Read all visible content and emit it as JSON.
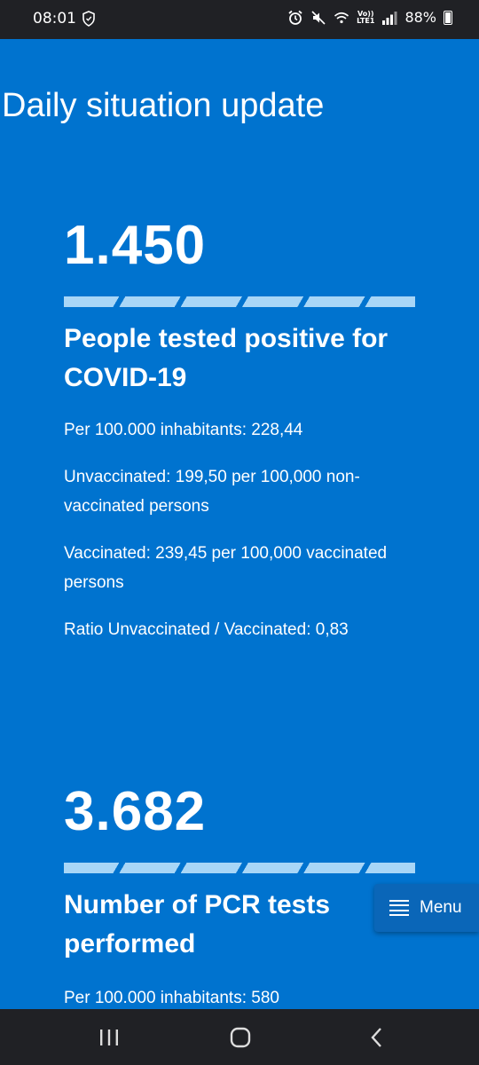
{
  "status_bar": {
    "time": "08:01",
    "battery_text": "88%",
    "network_label_top": "Vo))",
    "network_label_bottom": "LTE1"
  },
  "page_title": "Daily situation update",
  "stat_positive": {
    "value": "1.450",
    "heading": "People tested positive for COVID-19",
    "lines": [
      "Per 100.000 inhabitants: 228,44",
      "Unvaccinated: 199,50  per 100,000 non-vaccinated persons",
      "Vaccinated: 239,45  per 100,000 vaccinated persons",
      "Ratio Unvaccinated / Vaccinated: 0,83"
    ]
  },
  "stat_pcr": {
    "value": "3.682",
    "heading": "Number of PCR tests performed",
    "lines": [
      "Per 100.000 inhabitants: 580"
    ]
  },
  "menu_button": {
    "label": "Menu"
  },
  "colors": {
    "background": "#0073cf",
    "stripe": "#a8d6f7",
    "system_bar": "#202125"
  }
}
